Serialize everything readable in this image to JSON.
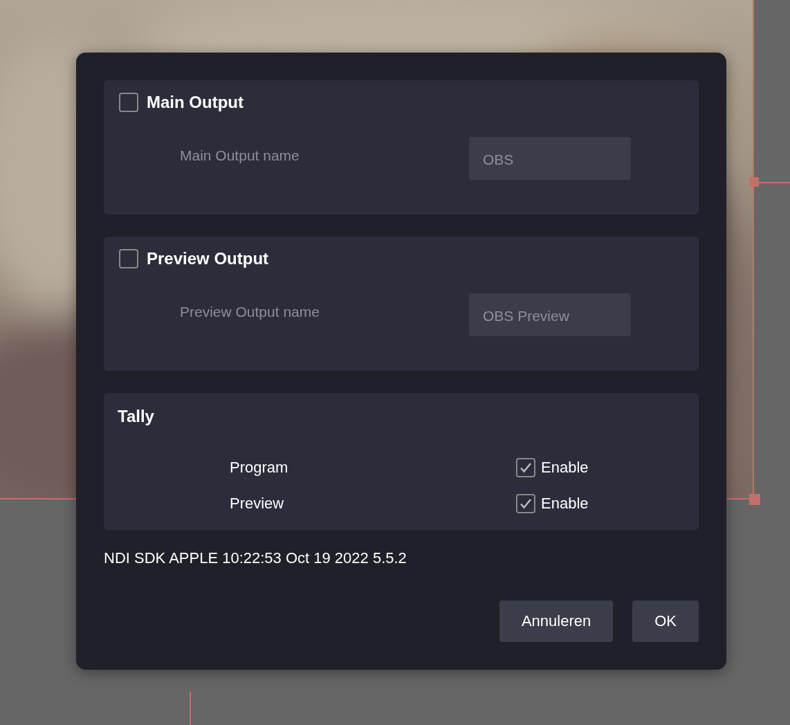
{
  "outputs": [
    {
      "title": "Main Output",
      "checked": false,
      "field_label": "Main Output name",
      "value": "OBS",
      "disabled": true
    },
    {
      "title": "Preview Output",
      "checked": false,
      "field_label": "Preview Output name",
      "value": "OBS Preview",
      "disabled": true
    }
  ],
  "tally": {
    "title": "Tally",
    "rows": [
      {
        "label": "Program",
        "option": "Enable",
        "checked": true
      },
      {
        "label": "Preview",
        "option": "Enable",
        "checked": true
      }
    ]
  },
  "version": "NDI SDK APPLE 10:22:53 Oct 19 2022 5.5.2",
  "buttons": [
    "Annuleren",
    "OK"
  ]
}
